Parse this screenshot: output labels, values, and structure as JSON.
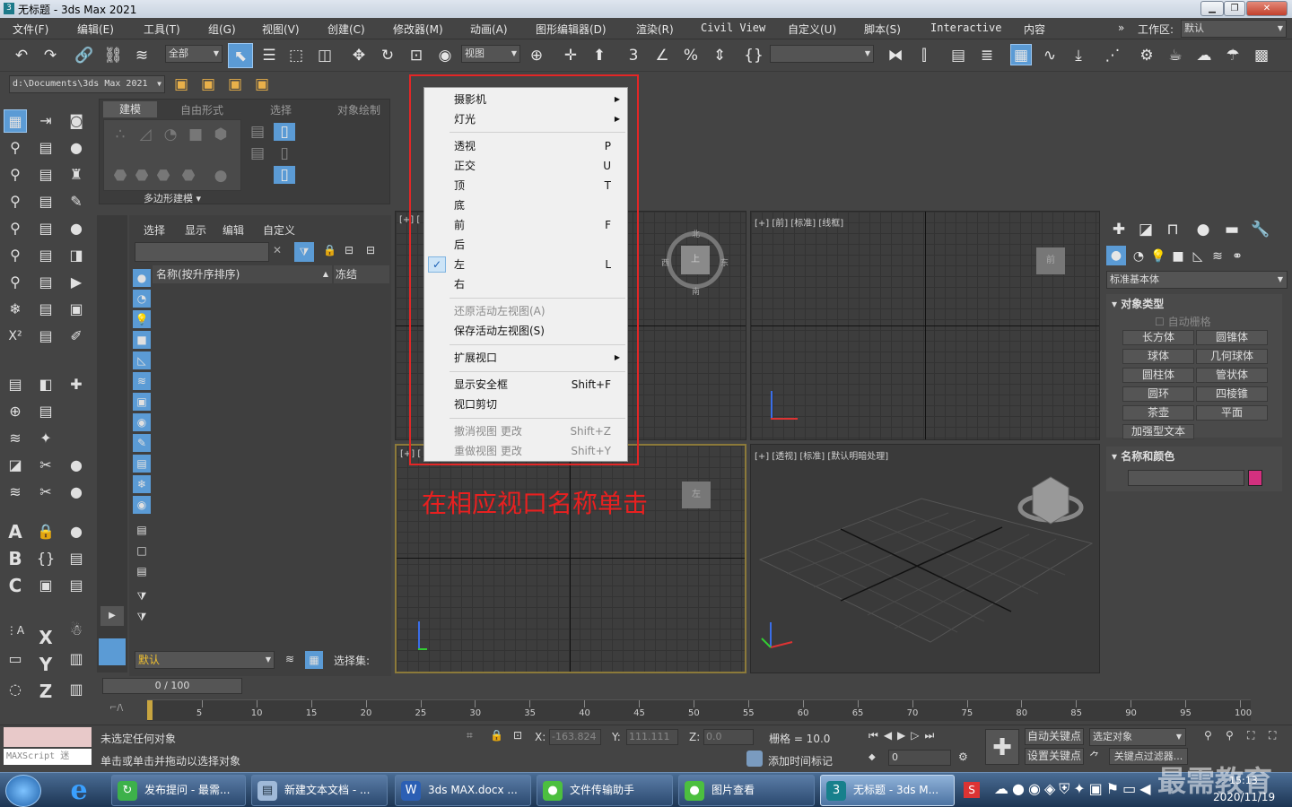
{
  "window": {
    "title": "无标题 - 3ds Max 2021",
    "icon_text": "3"
  },
  "menu": [
    "文件(F)",
    "编辑(E)",
    "工具(T)",
    "组(G)",
    "视图(V)",
    "创建(C)",
    "修改器(M)",
    "动画(A)",
    "图形编辑器(D)",
    "渲染(R)",
    "Civil View",
    "自定义(U)",
    "脚本(S)",
    "Interactive",
    "内容"
  ],
  "workspace": {
    "label": "工作区:",
    "value": "默认"
  },
  "toolbar": {
    "filter": "全部",
    "refcoord": "视图",
    "path": "d:\\Documents\\3ds Max 2021"
  },
  "ribbon": {
    "tabs": [
      "建模",
      "自由形式",
      "选择",
      "对象绘制"
    ],
    "group": "多边形建模"
  },
  "scene_explorer": {
    "tabs": [
      "选择",
      "显示",
      "编辑",
      "自定义"
    ],
    "col_name": "名称(按升序排序)",
    "col_freeze": "冻结",
    "layer": "默认",
    "selset_label": "选择集:"
  },
  "viewports": {
    "topleft_label": "[+] [",
    "front_label": "[+] [前] [标准] [线框]",
    "left_label": "[+] [",
    "persp_label": "[+] [透视] [标准] [默认明暗处理]",
    "cube_top": "上",
    "cube_front": "前",
    "cube_left": "左",
    "compass": [
      "北",
      "南",
      "东",
      "西"
    ]
  },
  "context_menu": {
    "camera": "摄影机",
    "light": "灯光",
    "views": [
      {
        "label": "透视",
        "key": "P"
      },
      {
        "label": "正交",
        "key": "U"
      },
      {
        "label": "顶",
        "key": "T"
      },
      {
        "label": "底",
        "key": ""
      },
      {
        "label": "前",
        "key": "F"
      },
      {
        "label": "后",
        "key": ""
      },
      {
        "label": "左",
        "key": "L",
        "checked": true
      },
      {
        "label": "右",
        "key": ""
      }
    ],
    "restore": "还原活动左视图(A)",
    "save": "保存活动左视图(S)",
    "extend": "扩展视口",
    "safe_frame": {
      "label": "显示安全框",
      "key": "Shift+F"
    },
    "clip": "视口剪切",
    "undo": {
      "label": "撤消视图 更改",
      "key": "Shift+Z"
    },
    "redo": {
      "label": "重做视图 更改",
      "key": "Shift+Y"
    },
    "check_mark": "✓"
  },
  "annotation": "在相应视口名称单击",
  "command_panel": {
    "category": "标准基本体",
    "rollout_object_type": "对象类型",
    "autogrid": "自动栅格",
    "buttons": [
      "长方体",
      "圆锥体",
      "球体",
      "几何球体",
      "圆柱体",
      "管状体",
      "圆环",
      "四棱锥",
      "茶壶",
      "平面",
      "加强型文本"
    ],
    "rollout_name_color": "名称和颜色",
    "swatch_color": "#d3307f"
  },
  "timeline": {
    "frame": "0 / 100",
    "ticks": [
      "5",
      "10",
      "15",
      "20",
      "25",
      "30",
      "35",
      "40",
      "45",
      "50",
      "55",
      "60",
      "65",
      "70",
      "75",
      "80",
      "85",
      "90",
      "95",
      "100"
    ]
  },
  "status": {
    "maxscript": "MAXScript 迷",
    "line1": "未选定任何对象",
    "line2": "单击或单击并拖动以选择对象",
    "x_label": "X:",
    "x": "-163.824",
    "y_label": "Y:",
    "y": "111.111",
    "z_label": "Z:",
    "z": "0.0",
    "grid": "栅格 = 10.0",
    "add_time_tag": "添加时间标记",
    "auto_key": "自动关键点",
    "selected": "选定对象",
    "set_key": "设置关键点",
    "key_filter": "关键点过滤器...",
    "frame_field": "0"
  },
  "taskbar": {
    "items": [
      "发布提问 - 最需...",
      "新建文本文档 - ...",
      "3ds MAX.docx ...",
      "文件传输助手",
      "图片查看",
      "无标题 - 3ds M..."
    ],
    "time": "15:13",
    "date": "2020/11/19",
    "watermark": "最需教育"
  }
}
